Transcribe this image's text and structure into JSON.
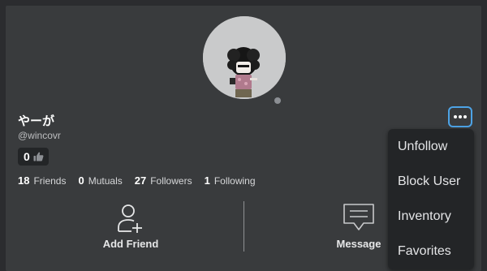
{
  "profile": {
    "display_name": "やーが",
    "username": "@wincovr",
    "likes_count": "0",
    "stats": [
      {
        "count": "18",
        "label": "Friends"
      },
      {
        "count": "0",
        "label": "Mutuals"
      },
      {
        "count": "27",
        "label": "Followers"
      },
      {
        "count": "1",
        "label": "Following"
      }
    ]
  },
  "actions": {
    "add_friend": "Add Friend",
    "message": "Message"
  },
  "menu": {
    "items": [
      "Unfollow",
      "Block User",
      "Inventory",
      "Favorites"
    ]
  },
  "colors": {
    "page_bg": "#2b2c2f",
    "card_bg": "#393b3d",
    "menu_bg": "#232527",
    "focus_ring": "#4da3e6"
  },
  "icons": {
    "like": "thumbs-up-icon",
    "add_friend": "person-plus-icon",
    "message": "chat-bubble-icon",
    "more": "more-horizontal-icon",
    "presence": "presence-dot-icon"
  }
}
